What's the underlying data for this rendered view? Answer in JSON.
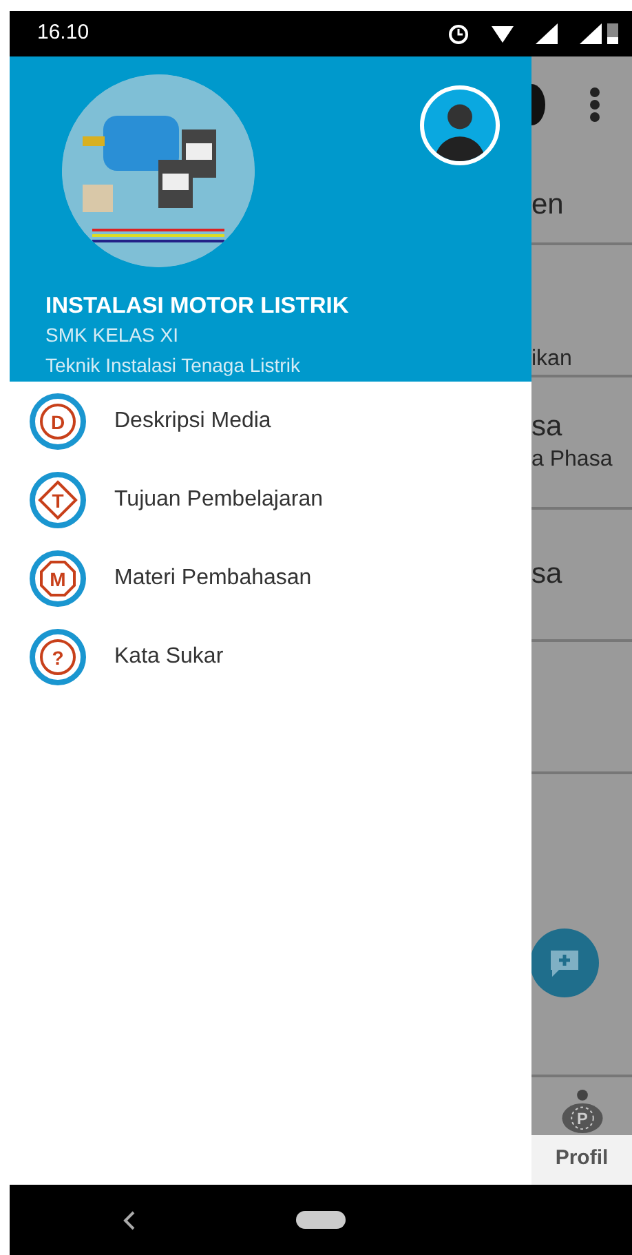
{
  "status_bar": {
    "time": "16.10"
  },
  "drawer": {
    "header": {
      "title": "INSTALASI MOTOR LISTRIK",
      "subtitle": "SMK KELAS XI",
      "caption": "Teknik Instalasi Tenaga Listrik"
    },
    "items": [
      {
        "label": "Deskripsi Media",
        "icon_letter": "D",
        "kind": "circle"
      },
      {
        "label": "Tujuan Pembelajaran",
        "icon_letter": "T",
        "kind": "diamond"
      },
      {
        "label": "Materi Pembahasan",
        "icon_letter": "M",
        "kind": "octagon"
      },
      {
        "label": "Kata Sukar",
        "icon_letter": "?",
        "kind": "circle"
      }
    ]
  },
  "background_screen": {
    "tab": "en",
    "rows": [
      {
        "subtitle": "ikan"
      },
      {
        "title": "sa",
        "subtitle": "a Phasa"
      },
      {
        "title": "sa"
      },
      {}
    ],
    "bottom_nav": [
      {
        "label": "Profil",
        "icon_letter": "P"
      }
    ]
  }
}
